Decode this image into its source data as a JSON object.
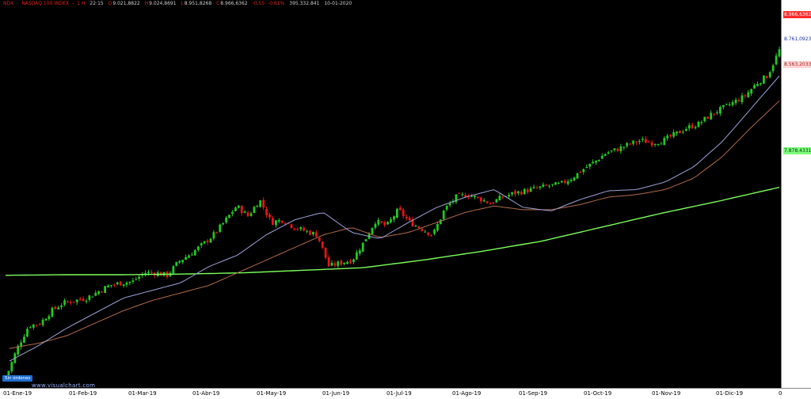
{
  "header": {
    "symbol": "NDX",
    "separator": "-",
    "name": "NASDAQ 100 INDEX",
    "interval": "1 H",
    "time": "22:15",
    "open_label": "O",
    "open": "9.021,8822",
    "high_label": "H",
    "high": "9.024,8691",
    "low_label": "L",
    "low": "8.951,8268",
    "close_label": "C",
    "close": "8.966,6362",
    "change": "-0,55",
    "change_pct": "-0,61%",
    "volume": "395.332.841",
    "date": "10-01-2020"
  },
  "price_labels": [
    {
      "text": "8.966,6362",
      "bg": "#ff2a2a",
      "fg": "#ffffff"
    },
    {
      "text": "8.761,0923",
      "bg": "#ffffff",
      "fg": "#2030a0"
    },
    {
      "text": "8.563,2033",
      "bg": "#ffd5d5",
      "fg": "#a02020"
    },
    {
      "text": "7.878,4331",
      "bg": "#7dff7d",
      "fg": "#003300"
    }
  ],
  "orders_button": "Sin órdenes",
  "watermark": "www.visualchart.com",
  "chart_data": {
    "type": "candlestick",
    "symbol": "NDX",
    "x_range": [
      "2019-01-01",
      "2020-01-10"
    ],
    "x_ticks": [
      "01-Ene-19",
      "01-Feb-19",
      "01-Mar-19",
      "01-Abr-19",
      "01-May-19",
      "01-Jun-19",
      "01-Jul-19",
      "01-Ago-19",
      "01-Sep-19",
      "01-Oct-19",
      "01-Nov-19",
      "01-Dic-19",
      "0"
    ],
    "ylim": [
      6350,
      9250
    ],
    "colors": {
      "up": "#22c822",
      "down": "#e81515",
      "ma_fast": "#9fa2d8",
      "ma_mid": "#b06a48",
      "ma_long": "#7cff5a"
    },
    "close_anchors": [
      6360,
      6600,
      6780,
      6800,
      6900,
      6960,
      6980,
      7000,
      7050,
      7100,
      7120,
      7130,
      7200,
      7200,
      7180,
      7290,
      7350,
      7420,
      7500,
      7610,
      7730,
      7650,
      7780,
      7600,
      7620,
      7560,
      7530,
      7500,
      7250,
      7280,
      7300,
      7440,
      7610,
      7570,
      7700,
      7600,
      7550,
      7500,
      7700,
      7800,
      7820,
      7790,
      7750,
      7800,
      7830,
      7850,
      7870,
      7890,
      7900,
      7950,
      8020,
      8080,
      8150,
      8180,
      8220,
      8250,
      8230,
      8250,
      8300,
      8350,
      8380,
      8450,
      8500,
      8550,
      8600,
      8700,
      8766,
      8966
    ],
    "ma_fast_anchors": [
      6500,
      6620,
      6760,
      6880,
      7000,
      7060,
      7120,
      7250,
      7340,
      7500,
      7620,
      7680,
      7520,
      7470,
      7600,
      7720,
      7800,
      7860,
      7720,
      7690,
      7780,
      7850,
      7860,
      7920,
      8040,
      8240,
      8500,
      8761
    ],
    "ma_mid_anchors": [
      6600,
      6640,
      6700,
      6800,
      6900,
      6980,
      7040,
      7100,
      7200,
      7300,
      7400,
      7500,
      7560,
      7480,
      7520,
      7600,
      7680,
      7730,
      7700,
      7700,
      7740,
      7800,
      7820,
      7860,
      7950,
      8120,
      8350,
      8563
    ],
    "ma_long_anchors": [
      7180,
      7185,
      7185,
      7190,
      7200,
      7220,
      7240,
      7300,
      7370,
      7450,
      7560,
      7670,
      7770,
      7878
    ]
  }
}
